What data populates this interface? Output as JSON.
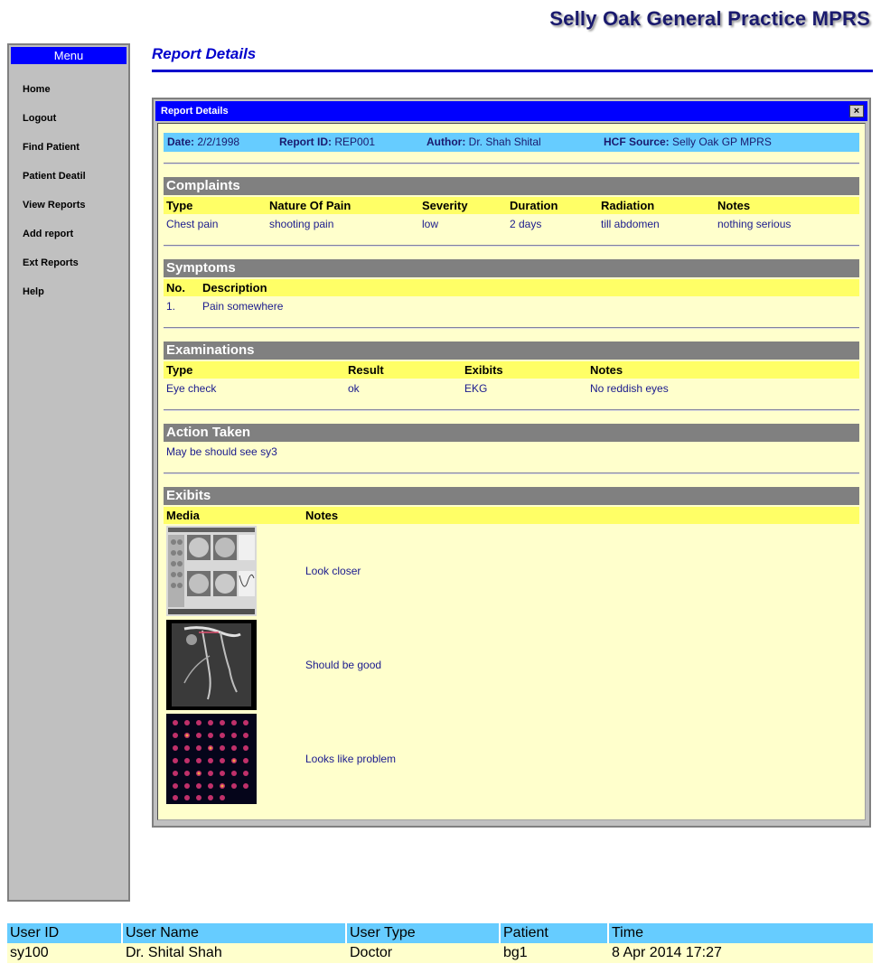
{
  "app_title": "Selly Oak General Practice MPRS",
  "menu": {
    "title": "Menu",
    "items": [
      "Home",
      "Logout",
      "Find Patient",
      "Patient Deatil",
      "View Reports",
      "Add report",
      "Ext Reports",
      "Help"
    ]
  },
  "page_heading": "Report Details",
  "window": {
    "title": "Report Details",
    "close_glyph": "×"
  },
  "meta": {
    "date_label": "Date:",
    "date": "2/2/1998",
    "report_id_label": "Report ID:",
    "report_id": "REP001",
    "author_label": "Author:",
    "author": "Dr. Shah Shital",
    "hcf_label": "HCF Source:",
    "hcf": "Selly Oak GP MPRS"
  },
  "complaints": {
    "title": "Complaints",
    "columns": [
      "Type",
      "Nature Of Pain",
      "Severity",
      "Duration",
      "Radiation",
      "Notes"
    ],
    "rows": [
      [
        "Chest pain",
        "shooting pain",
        "low",
        "2 days",
        "till abdomen",
        "nothing serious"
      ]
    ]
  },
  "symptoms": {
    "title": "Symptoms",
    "columns": [
      "No.",
      "Description"
    ],
    "rows": [
      [
        "1.",
        "Pain somewhere"
      ]
    ]
  },
  "examinations": {
    "title": "Examinations",
    "columns": [
      "Type",
      "Result",
      "Exibits",
      "Notes"
    ],
    "rows": [
      [
        "Eye check",
        "ok",
        "EKG",
        "No reddish eyes"
      ]
    ]
  },
  "action_taken": {
    "title": "Action Taken",
    "text": "May be should see sy3"
  },
  "exhibits": {
    "title": "Exibits",
    "columns": [
      "Media",
      "Notes"
    ],
    "rows": [
      {
        "media": "scan-grid-thumbnail",
        "note": "Look closer"
      },
      {
        "media": "angiogram-thumbnail",
        "note": "Should be good"
      },
      {
        "media": "heart-slices-thumbnail",
        "note": "Looks like problem"
      }
    ]
  },
  "footer": {
    "columns": [
      "User ID",
      "User Name",
      "User Type",
      "Patient",
      "Time"
    ],
    "values": [
      "sy100",
      "Dr. Shital Shah",
      "Doctor",
      "bg1",
      "8 Apr 2014 17:27"
    ]
  },
  "colors": {
    "menu_header": "#0000ff",
    "window_title": "#0000ff",
    "meta_bar": "#66ccff",
    "section_title": "#808080",
    "column_header": "#ffff66",
    "panel_bg": "#ffffcc",
    "text": "#1a1a8e"
  }
}
